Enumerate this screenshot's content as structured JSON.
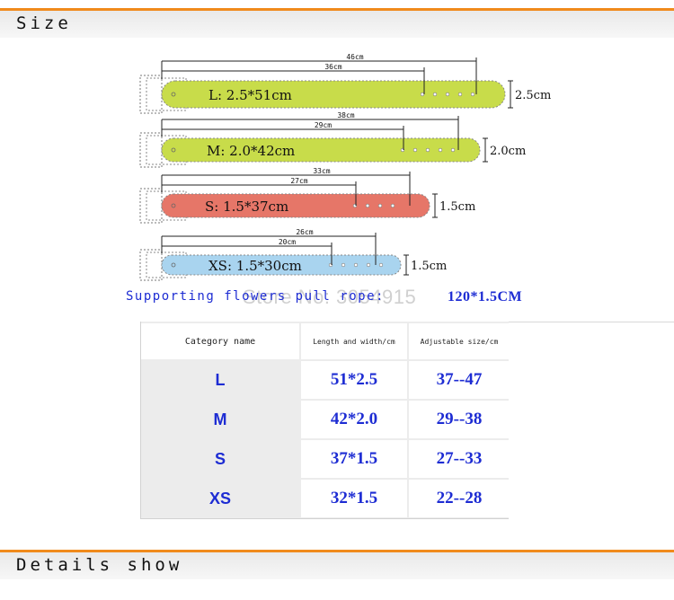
{
  "sections": {
    "size_title": "Size",
    "details_title": "Details show"
  },
  "belts": [
    {
      "label": "L: 2.5*51cm",
      "outer": "46cm",
      "inner": "36cm",
      "width": "2.5cm",
      "color": "#c8dc4a"
    },
    {
      "label": "M: 2.0*42cm",
      "outer": "38cm",
      "inner": "29cm",
      "width": "2.0cm",
      "color": "#c8dc4a"
    },
    {
      "label": "S: 1.5*37cm",
      "outer": "33cm",
      "inner": "27cm",
      "width": "1.5cm",
      "color": "#e67668"
    },
    {
      "label": "XS: 1.5*30cm",
      "outer": "26cm",
      "inner": "20cm",
      "width": "1.5cm",
      "color": "#a9d4ef"
    }
  ],
  "caption": {
    "text": "Supporting flowers pull rope:",
    "spec": "120*1.5CM",
    "watermark": "Store No: 3054915"
  },
  "table": {
    "headers": [
      "Category name",
      "Length and width/cm",
      "Adjustable size/cm"
    ],
    "rows": [
      [
        "L",
        "51*2.5",
        "37--47"
      ],
      [
        "M",
        "42*2.0",
        "29--38"
      ],
      [
        "S",
        "37*1.5",
        "27--33"
      ],
      [
        "XS",
        "32*1.5",
        "22--28"
      ]
    ]
  },
  "colors": {
    "accent": "#f08a1c",
    "text_blue": "#1d2cd3",
    "belt_green": "#c8dc4a",
    "belt_red": "#e67668",
    "belt_blue": "#a9d4ef"
  }
}
